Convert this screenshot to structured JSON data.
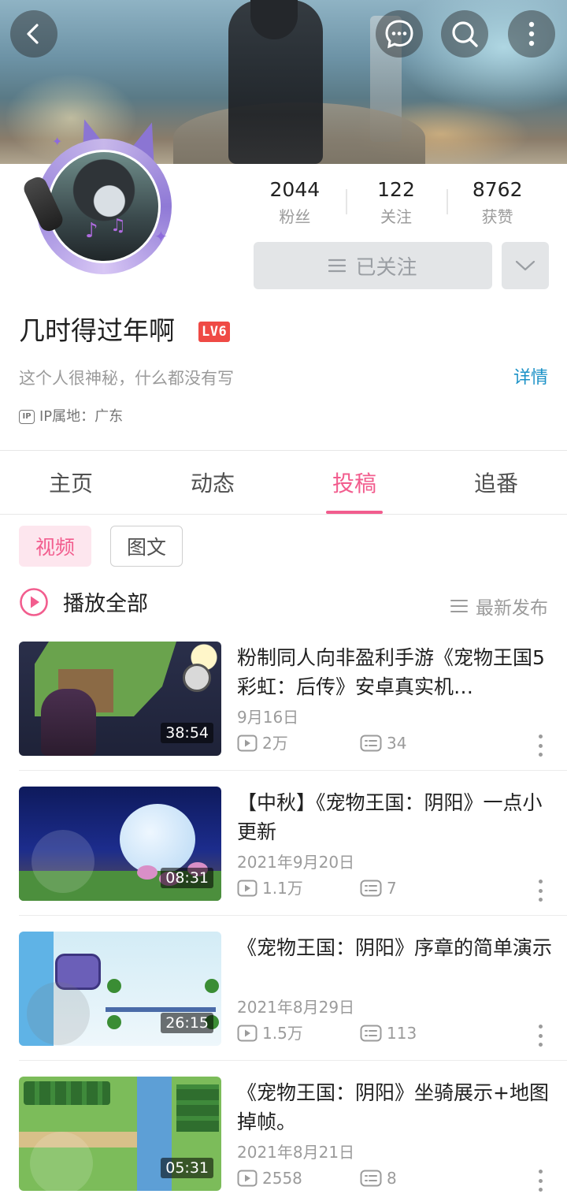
{
  "header": {
    "back_icon": "back-arrow-icon",
    "message_icon": "chat-bubble-icon",
    "search_icon": "search-icon",
    "more_icon": "more-vertical-icon"
  },
  "profile": {
    "stats": [
      {
        "value": "2044",
        "label": "粉丝"
      },
      {
        "value": "122",
        "label": "关注"
      },
      {
        "value": "8762",
        "label": "获赞"
      }
    ],
    "follow_label": "已关注",
    "username": "几时得过年啊",
    "level": "LV6",
    "bio": "这个人很神秘，什么都没有写",
    "detail_link": "详情",
    "ip_icon": "IP",
    "ip_location": "IP属地：广东"
  },
  "tabs": [
    {
      "label": "主页",
      "active": false
    },
    {
      "label": "动态",
      "active": false
    },
    {
      "label": "投稿",
      "active": true
    },
    {
      "label": "追番",
      "active": false
    }
  ],
  "filters": {
    "video": "视频",
    "article": "图文"
  },
  "play_all": "播放全部",
  "sort": "最新发布",
  "colors": {
    "accent": "#f25d8e",
    "link": "#1c92c7",
    "level": "#ef4a45"
  },
  "videos": [
    {
      "title": "粉制同人向非盈利手游《宠物王国5彩虹：后传》安卓真实机…",
      "date": "9月16日",
      "plays": "2万",
      "comments": "34",
      "duration": "38:54"
    },
    {
      "title": "【中秋】《宠物王国：阴阳》一点小更新",
      "date": "2021年9月20日",
      "plays": "1.1万",
      "comments": "7",
      "duration": "08:31"
    },
    {
      "title": "《宠物王国：阴阳》序章的简单演示",
      "date": "2021年8月29日",
      "plays": "1.5万",
      "comments": "113",
      "duration": "26:15"
    },
    {
      "title": "《宠物王国：阴阳》坐骑展示+地图掉帧。",
      "date": "2021年8月21日",
      "plays": "2558",
      "comments": "8",
      "duration": "05:31"
    }
  ]
}
